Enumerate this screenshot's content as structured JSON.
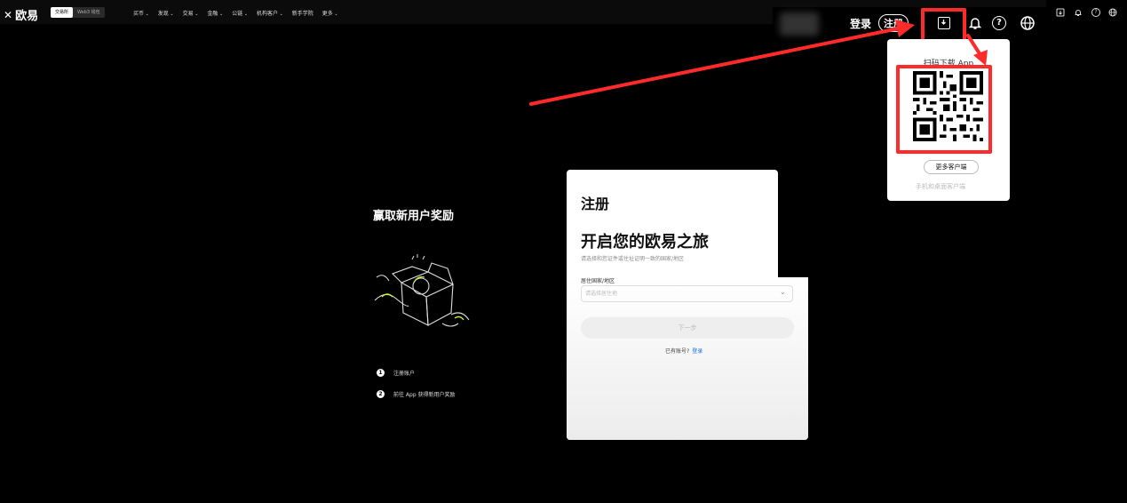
{
  "topbar": {
    "logo_text": "欧易",
    "mode_tabs": [
      "交易所",
      "Web3 钱包"
    ],
    "nav_items": [
      "买币",
      "发现",
      "交易",
      "金融",
      "公链",
      "机构客户",
      "新手学院",
      "更多"
    ]
  },
  "rightbar": {
    "icons": [
      "download-icon",
      "bell-icon",
      "help-icon",
      "globe-icon"
    ]
  },
  "zoom_header": {
    "login": "登录",
    "register": "注册"
  },
  "popup": {
    "title": "扫码下载 App",
    "more_clients": "更多客户端",
    "footer": "手机和桌面客户端"
  },
  "promo": {
    "title": "赢取新用户奖励",
    "steps": [
      {
        "num": "1",
        "text": "注册账户"
      },
      {
        "num": "2",
        "text": "前往 App 获得新用户奖励"
      }
    ]
  },
  "card": {
    "heading": "注册",
    "subheading": "开启您的欧易之旅",
    "description": "请选择和您证件或住址证明一致的国家/地区",
    "country_label": "居住国家/地区",
    "country_placeholder": "请选择居住地",
    "next_button": "下一步",
    "has_account": "已有账号?",
    "login_link": "登录"
  },
  "colors": {
    "highlight": "#ff2b2b",
    "link": "#1a6fe0",
    "accent_green": "#c8f53c"
  }
}
